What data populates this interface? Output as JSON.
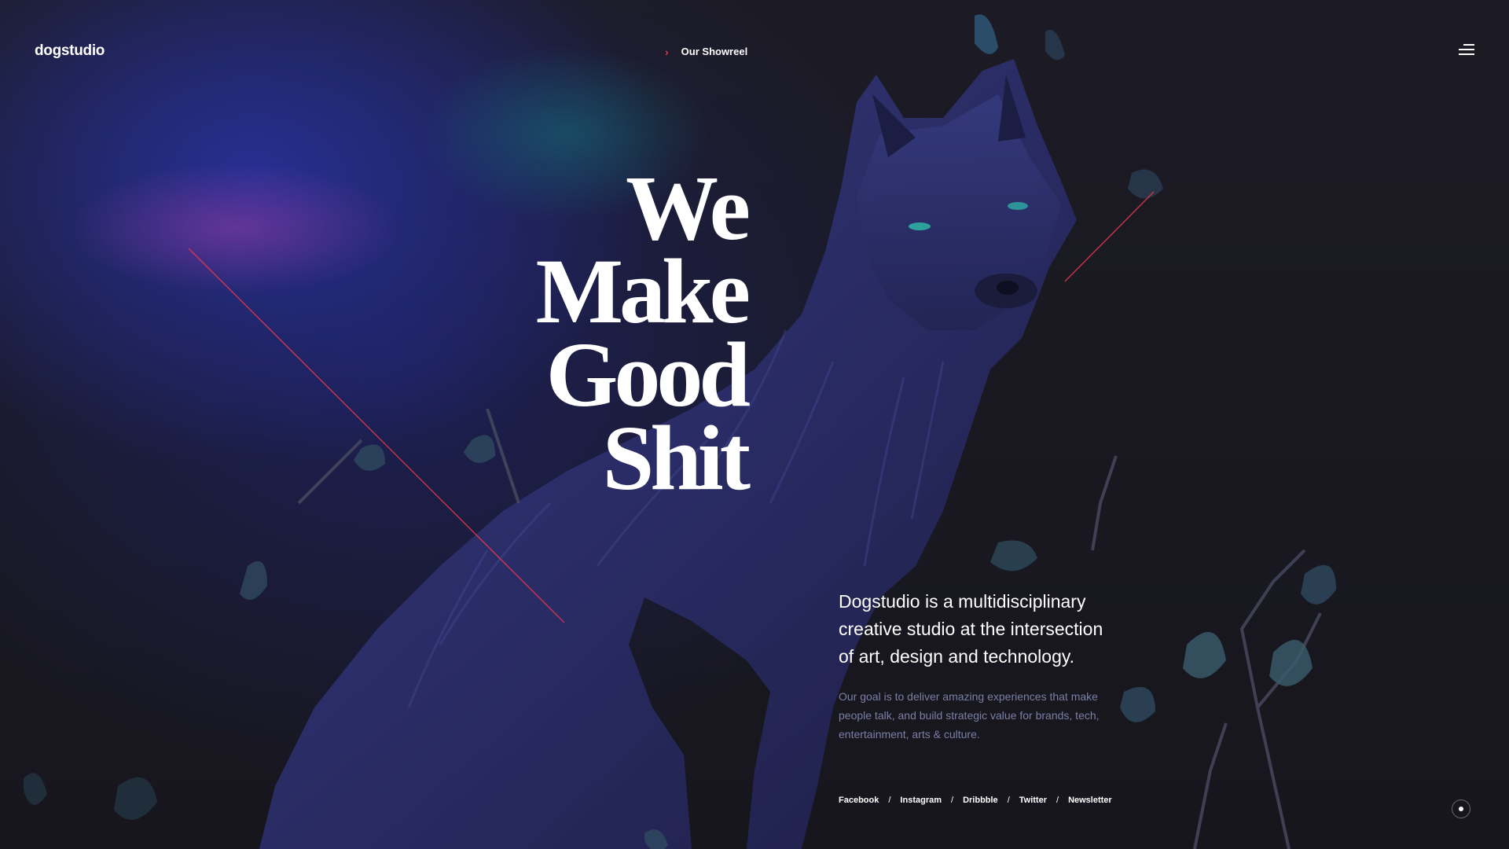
{
  "header": {
    "logo": "dogstudio",
    "showreel_label": "Our Showreel",
    "showreel_icon": "chevron-right-icon",
    "menu_icon": "hamburger-menu-icon"
  },
  "hero": {
    "headline": [
      "We",
      "Make",
      "Good",
      "Shit"
    ],
    "intro": "Dogstudio is a multidisciplinary creative studio at the intersection of art, design and technology.",
    "goal": "Our goal is to deliver amazing experiences that make people talk, and build strategic value for brands, tech, entertainment, arts & culture."
  },
  "social": {
    "links": [
      "Facebook",
      "Instagram",
      "Dribbble",
      "Twitter",
      "Newsletter"
    ],
    "separator": "/"
  },
  "colors": {
    "accent": "#e0394b",
    "background": "#17161d",
    "muted_text": "#7b7fa6"
  }
}
